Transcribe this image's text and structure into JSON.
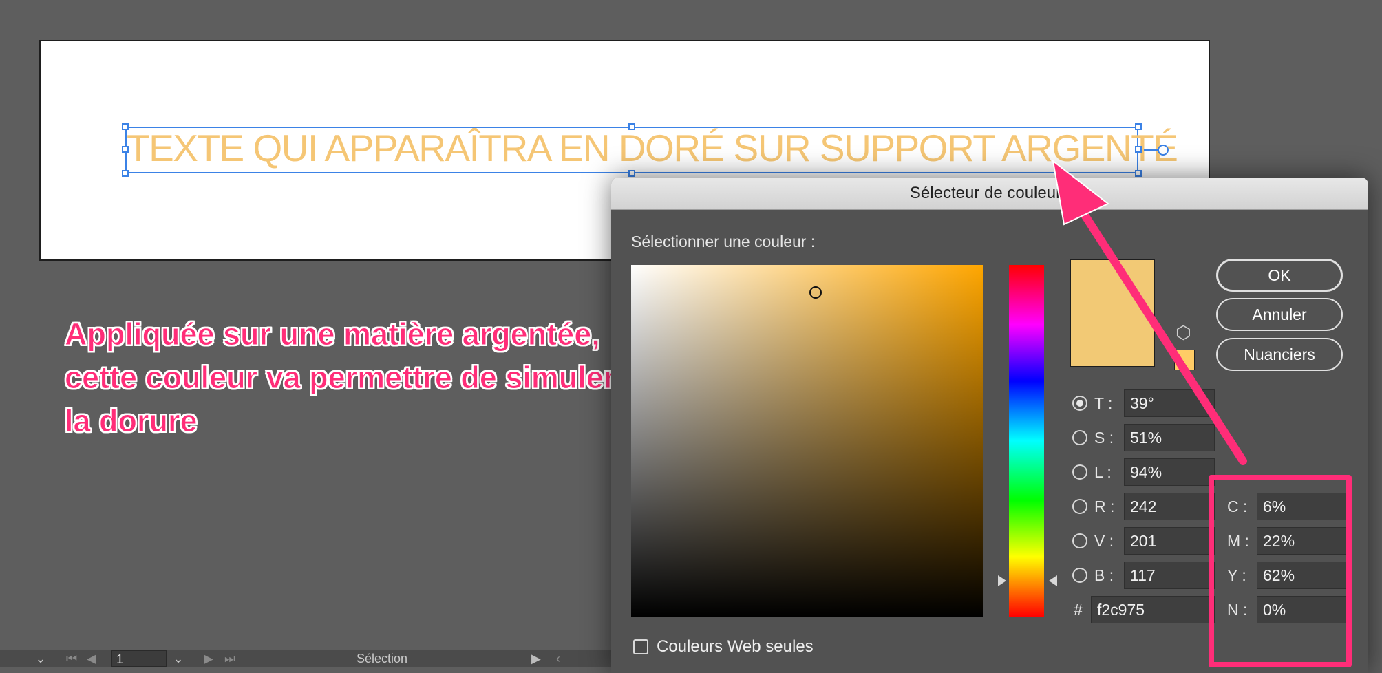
{
  "artboard": {
    "selected_text": "TEXTE QUI APPARAÎTRA EN DORÉ SUR SUPPORT ARGENTÉ"
  },
  "annotation": {
    "lines": [
      "Appliquée sur une matière argentée,",
      "cette couleur va permettre de simuler",
      "la dorure"
    ],
    "color": "#ff2d78"
  },
  "statusbar": {
    "page_number": "1",
    "tool_label": "Sélection"
  },
  "color_picker": {
    "title": "Sélecteur de couleurs",
    "prompt": "Sélectionner une couleur :",
    "current_color": "#f2c975",
    "hsb_mode": "T",
    "fields": {
      "T": {
        "label": "T :",
        "value": "39°"
      },
      "S": {
        "label": "S :",
        "value": "51%"
      },
      "L": {
        "label": "L :",
        "value": "94%"
      },
      "R": {
        "label": "R :",
        "value": "242"
      },
      "V": {
        "label": "V :",
        "value": "201"
      },
      "B": {
        "label": "B :",
        "value": "117"
      }
    },
    "hex": {
      "label": "#",
      "value": "f2c975"
    },
    "cmyk": {
      "C": {
        "label": "C :",
        "value": "6%"
      },
      "M": {
        "label": "M :",
        "value": "22%"
      },
      "Y": {
        "label": "Y :",
        "value": "62%"
      },
      "N": {
        "label": "N :",
        "value": "0%"
      }
    },
    "buttons": {
      "ok": "OK",
      "cancel": "Annuler",
      "swatches": "Nuanciers"
    },
    "web_only_label": "Couleurs Web seules",
    "web_only_checked": false,
    "websafe_swatch_color": "#ffcc66"
  }
}
